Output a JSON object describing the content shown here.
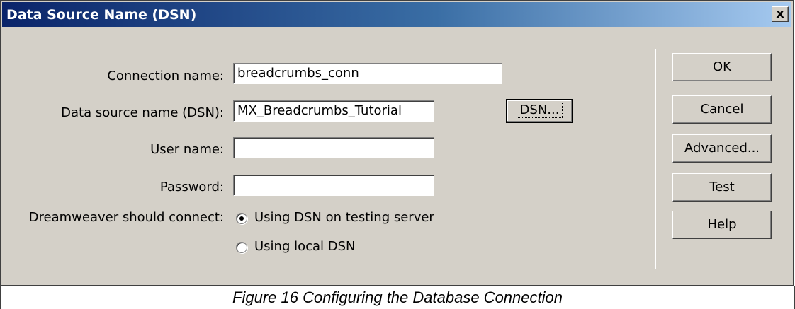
{
  "window": {
    "title": "Data Source Name (DSN)",
    "close_label": "x"
  },
  "form": {
    "connection_name": {
      "label": "Connection name:",
      "value": "breadcrumbs_conn"
    },
    "dsn": {
      "label": "Data source name (DSN):",
      "value": "MX_Breadcrumbs_Tutorial",
      "browse_label": "DSN..."
    },
    "user_name": {
      "label": "User name:",
      "value": ""
    },
    "password": {
      "label": "Password:",
      "value": ""
    },
    "connect": {
      "label": "Dreamweaver should connect:",
      "options": [
        {
          "label": "Using DSN on testing server",
          "selected": true
        },
        {
          "label": "Using local DSN",
          "selected": false
        }
      ]
    }
  },
  "buttons": {
    "ok": "OK",
    "cancel": "Cancel",
    "advanced": "Advanced...",
    "test": "Test",
    "help": "Help"
  },
  "caption": "Figure 16 Configuring the Database Connection"
}
